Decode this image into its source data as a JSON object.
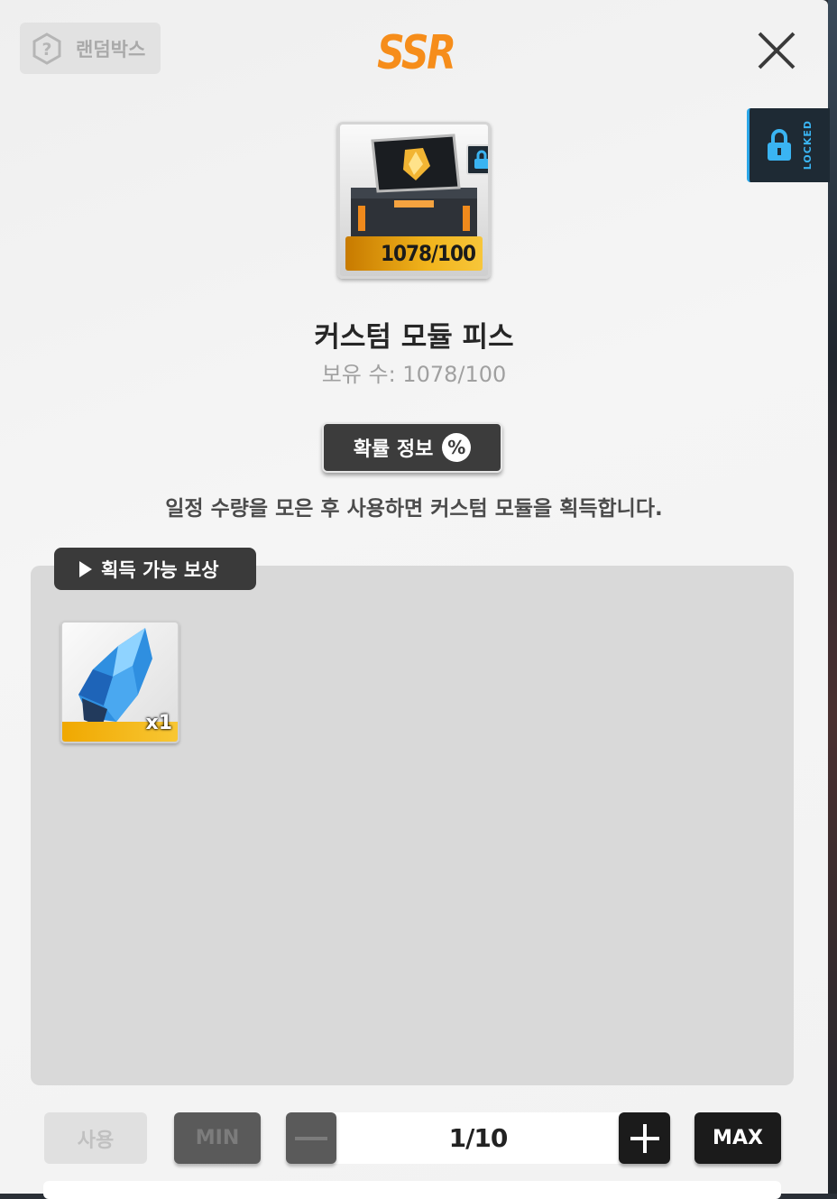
{
  "header": {
    "random_box_label": "랜덤박스",
    "rarity": "SSR",
    "locked_label": "LOCKED"
  },
  "item": {
    "count_badge": "1078/100",
    "name": "커스텀 모듈 피스",
    "owned_text": "보유 수: 1078/100",
    "probability_label": "확률 정보",
    "probability_icon": "%",
    "description": "일정 수량을 모은 후 사용하면 커스텀 모듈을 획득합니다."
  },
  "rewards": {
    "tab_label": "획득 가능 보상",
    "items": [
      {
        "icon": "blue-crystal-module-icon",
        "quantity": "x1"
      }
    ]
  },
  "controls": {
    "use_label": "사용",
    "min_label": "MIN",
    "quantity_value": "1/10",
    "max_label": "MAX"
  },
  "colors": {
    "rarity_orange": "#f68d1a",
    "lock_blue": "#2aa6e8",
    "dark_button": "#1b1b1b",
    "count_gold": "#f1b41c"
  }
}
